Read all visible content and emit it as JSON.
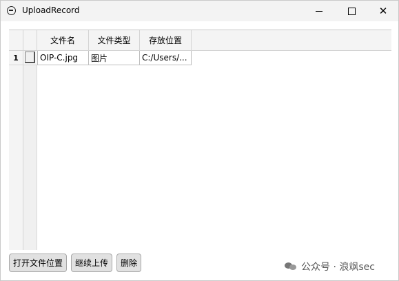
{
  "window": {
    "title": "UploadRecord",
    "controls": {
      "minimize": "minimize-icon",
      "maximize": "maximize-icon",
      "close": "close-icon"
    }
  },
  "table": {
    "columns": [
      "文件名",
      "文件类型",
      "存放位置"
    ],
    "rows": [
      {
        "index": "1",
        "checked": false,
        "cells": [
          "OIP-C.jpg",
          "图片",
          "C:/Users/..."
        ]
      }
    ]
  },
  "buttons": {
    "open_location": "打开文件位置",
    "continue_upload": "继续上传",
    "delete": "删除"
  },
  "watermark": {
    "text": "公众号 · 浪飒sec"
  }
}
